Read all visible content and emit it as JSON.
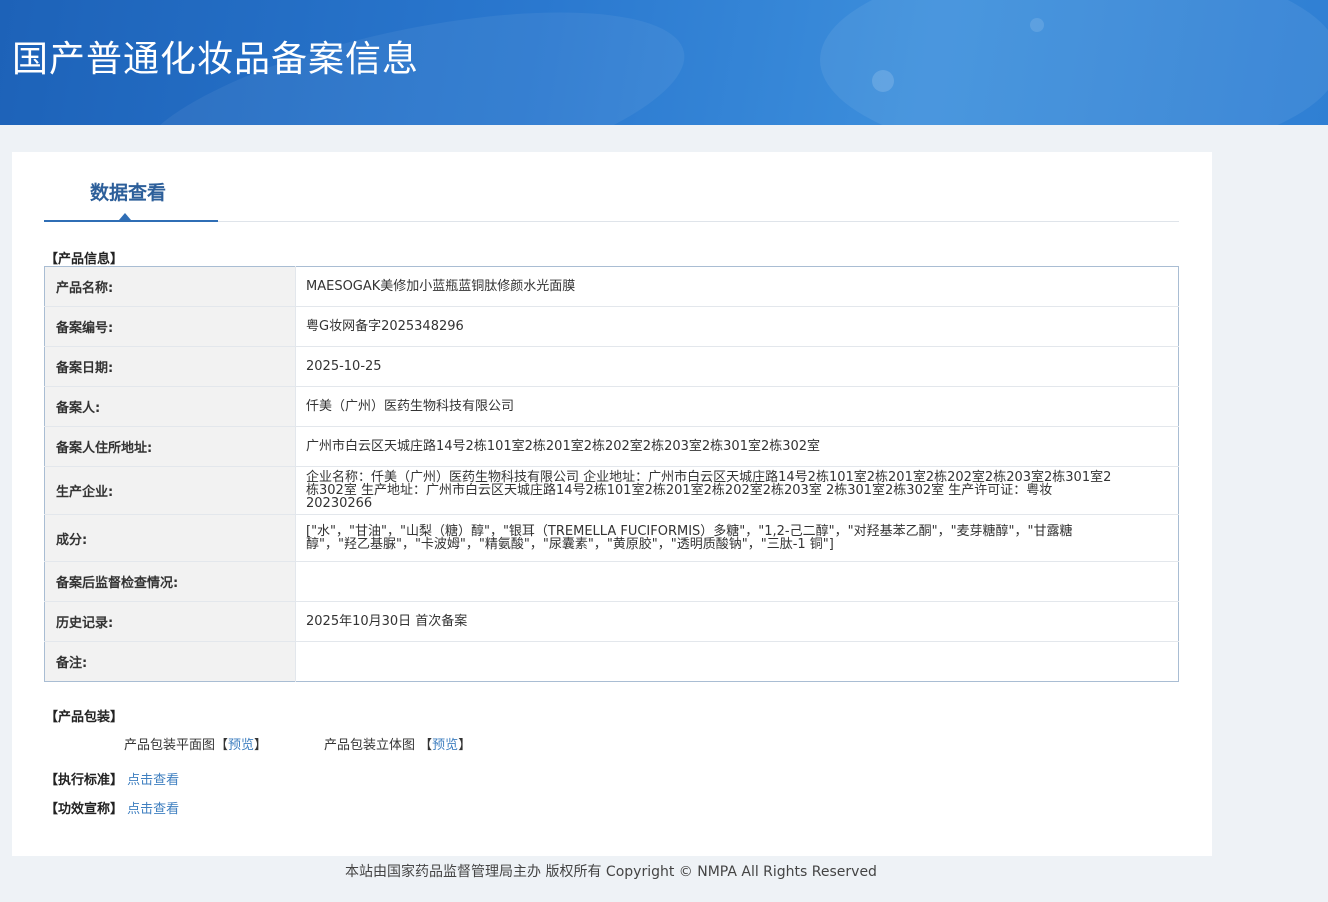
{
  "header": {
    "title": "国产普通化妆品备案信息"
  },
  "tab": {
    "label": "数据查看"
  },
  "product_info": {
    "section_title": "【产品信息】",
    "rows": [
      {
        "key": "产品名称:",
        "value": "MAESOGAK美修加小蓝瓶蓝铜肽修颜水光面膜"
      },
      {
        "key": "备案编号:",
        "value": "粤G妆网备字2025348296"
      },
      {
        "key": "备案日期:",
        "value": "2025-10-25"
      },
      {
        "key": "备案人:",
        "value": "仟美（广州）医药生物科技有限公司"
      },
      {
        "key": "备案人住所地址:",
        "value": "广州市白云区天城庄路14号2栋101室2栋201室2栋202室2栋203室2栋301室2栋302室"
      },
      {
        "key": "生产企业:",
        "value": "企业名称：仟美（广州）医药生物科技有限公司 企业地址：广州市白云区天城庄路14号2栋101室2栋201室2栋202室2栋203室2栋301室2栋302室 生产地址：广州市白云区天城庄路14号2栋101室2栋201室2栋202室2栋203室 2栋301室2栋302室 生产许可证：粤妆20230266"
      },
      {
        "key": "成分:",
        "value": "[\"水\"，\"甘油\"，\"山梨（糖）醇\"，\"银耳（TREMELLA FUCIFORMIS）多糖\"，\"1,2-己二醇\"，\"对羟基苯乙酮\"，\"麦芽糖醇\"，\"甘露糖醇\"，\"羟乙基脲\"，\"卡波姆\"，\"精氨酸\"，\"尿囊素\"，\"黄原胶\"，\"透明质酸钠\"，\"三肽-1 铜\"]"
      },
      {
        "key": "备案后监督检查情况:",
        "value": ""
      },
      {
        "key": "历史记录:",
        "value": "2025年10月30日 首次备案"
      },
      {
        "key": "备注:",
        "value": ""
      }
    ]
  },
  "packaging": {
    "section_title": "【产品包装】",
    "flat_label": "产品包装平面图",
    "stereo_label": "产品包装立体图",
    "bracket_open": "【",
    "bracket_close": "】",
    "preview_label": "预览"
  },
  "standard": {
    "section_title": "【执行标准】",
    "link_label": "点击查看"
  },
  "efficacy": {
    "section_title": "【功效宣称】",
    "link_label": "点击查看"
  },
  "footer": {
    "text": "本站由国家药品监督管理局主办 版权所有 Copyright © NMPA All Rights Reserved"
  }
}
